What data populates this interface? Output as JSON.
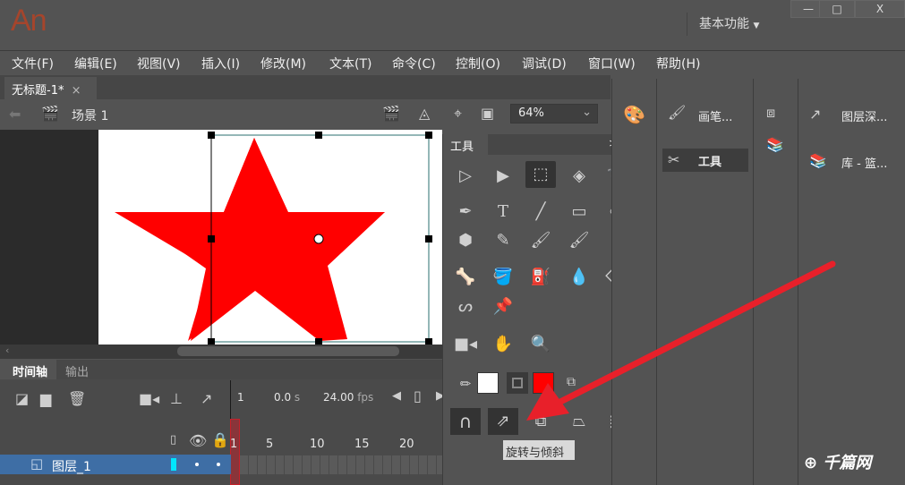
{
  "app": {
    "logo": "An",
    "workspace": "基本功能",
    "window_controls": [
      "—",
      "□",
      "X"
    ]
  },
  "menu": [
    "文件(F)",
    "编辑(E)",
    "视图(V)",
    "插入(I)",
    "修改(M)",
    "文本(T)",
    "命令(C)",
    "控制(O)",
    "调试(D)",
    "窗口(W)",
    "帮助(H)"
  ],
  "document": {
    "tab": "无标题-1*",
    "close": "×",
    "scene": "场景 1",
    "zoom": "64%"
  },
  "stage": {
    "shape": "star",
    "fill": "#ff0000"
  },
  "timeline": {
    "tabs": [
      "时间轴",
      "输出"
    ],
    "frame": "1",
    "time": "0.0",
    "time_unit": "s",
    "fps": "24.00",
    "fps_unit": "fps",
    "ruler": [
      "1",
      "5",
      "10",
      "15",
      "20"
    ],
    "layer": "图层_1"
  },
  "tools": {
    "title": "工具",
    "expand": ">>",
    "tooltip": "旋转与倾斜",
    "stroke_color": "#ffffff",
    "fill_color": "#ff0000"
  },
  "panels": {
    "brush": "画笔...",
    "tools": "工具",
    "layer_depth": "图层深...",
    "library": "库 - 篮..."
  },
  "watermark": "千篇网",
  "accent": {
    "arrow": "#e8202a",
    "layer_selected": "#3e6ea5",
    "playhead": "#c8202a"
  }
}
